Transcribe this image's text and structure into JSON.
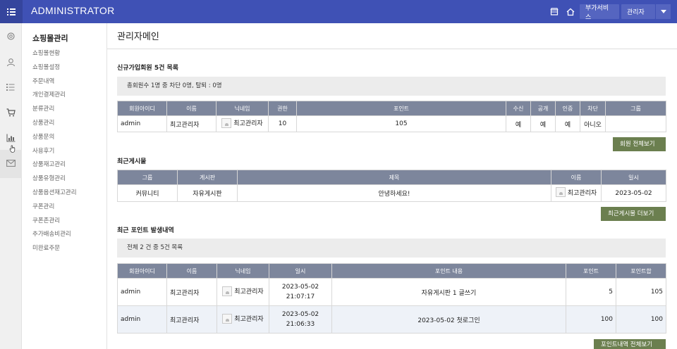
{
  "app": {
    "brand": "ADMINISTRATOR"
  },
  "topbar": {
    "service_label": "부가서비스",
    "user_label": "관리자"
  },
  "sidemenu": {
    "title": "쇼핑몰관리",
    "items": [
      "쇼핑몰현황",
      "쇼핑몰설정",
      "주문내역",
      "개인결제관리",
      "분류관리",
      "상품관리",
      "상품문의",
      "사용후기",
      "상품재고관리",
      "상품유형관리",
      "상품옵션재고관리",
      "쿠폰관리",
      "쿠폰존관리",
      "추가배송비관리",
      "미완료주문"
    ]
  },
  "page": {
    "title": "관리자메인"
  },
  "members": {
    "title": "신규가입회원 5건 목록",
    "summary": "총회원수 1명 중 차단 0명, 탈퇴 : 0명",
    "headers": [
      "회원아이디",
      "이름",
      "닉네임",
      "권한",
      "포인트",
      "수신",
      "공개",
      "인증",
      "차단",
      "그룹"
    ],
    "rows": [
      {
        "id": "admin",
        "name": "최고관리자",
        "nick": "최고관리자",
        "level": "10",
        "point": "105",
        "mail": "예",
        "open": "예",
        "cert": "예",
        "block": "아니오",
        "group": ""
      }
    ],
    "button": "회원 전체보기"
  },
  "posts": {
    "title": "최근게시물",
    "headers": [
      "그룹",
      "게시판",
      "제목",
      "이름",
      "일시"
    ],
    "rows": [
      {
        "group": "커뮤니티",
        "board": "자유게시판",
        "subject": "안녕하세요!",
        "name": "최고관리자",
        "date": "2023-05-02"
      }
    ],
    "button": "최근게시물 더보기"
  },
  "points": {
    "title": "최근 포인트 발생내역",
    "summary": "전체 2 건 중 5건 목록",
    "headers": [
      "회원아이디",
      "이름",
      "닉네임",
      "일시",
      "포인트 내용",
      "포인트",
      "포인트합"
    ],
    "rows": [
      {
        "id": "admin",
        "name": "최고관리자",
        "nick": "최고관리자",
        "date": "2023-05-02",
        "time": "21:07:17",
        "content": "자유게시판 1 글쓰기",
        "point": "5",
        "total": "105"
      },
      {
        "id": "admin",
        "name": "최고관리자",
        "nick": "최고관리자",
        "date": "2023-05-02",
        "time": "21:06:33",
        "content": "2023-05-02 첫로그인",
        "point": "100",
        "total": "100"
      }
    ],
    "button": "포인트내역 전체보기"
  },
  "colors": {
    "topbar": "#3f51b5",
    "table_header": "#7d869c",
    "button": "#6b7f4f"
  }
}
